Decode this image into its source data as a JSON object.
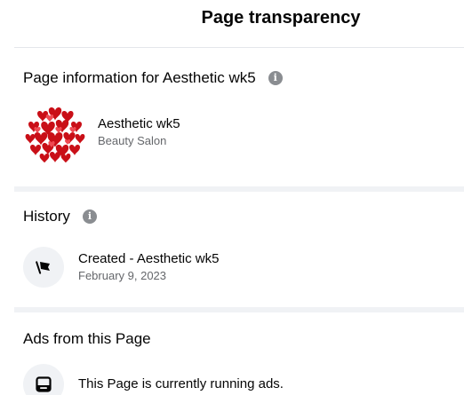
{
  "header": {
    "title": "Page transparency"
  },
  "page_info": {
    "heading": "Page information for Aesthetic wk5",
    "info_icon": "info-icon",
    "name": "Aesthetic wk5",
    "category": "Beauty Salon",
    "avatar_icon": "hearts-avatar"
  },
  "history": {
    "heading": "History",
    "info_icon": "info-icon",
    "event": "Created - Aesthetic wk5",
    "date": "February 9, 2023",
    "event_icon": "flag-icon"
  },
  "ads": {
    "heading": "Ads from this Page",
    "status": "This Page is currently running ads.",
    "status_icon": "ads-icon"
  },
  "colors": {
    "primary_text": "#050505",
    "secondary_text": "#65676b",
    "icon_gray": "#8a8d91",
    "icon_bg": "#f0f2f5",
    "heart_red": "#d4141c"
  }
}
